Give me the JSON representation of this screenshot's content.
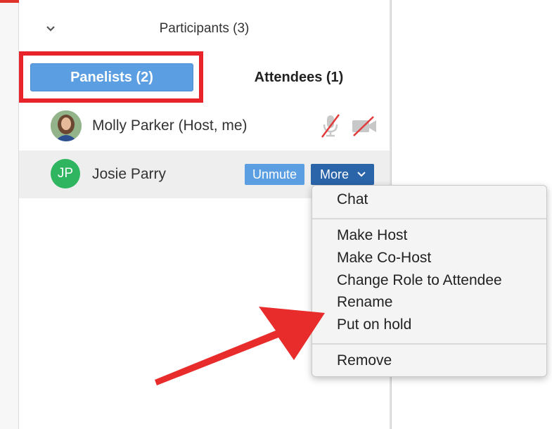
{
  "participants": {
    "header_title": "Participants (3)",
    "tabs": [
      {
        "label": "Panelists (2)",
        "active": true
      },
      {
        "label": "Attendees (1)",
        "active": false
      }
    ],
    "rows": [
      {
        "name": "Molly Parker (Host, me)",
        "avatar": "photo",
        "mic": "muted",
        "video": "off"
      },
      {
        "name": "Josie Parry",
        "avatar_initials": "JP",
        "avatar_color": "#2fb560",
        "buttons": {
          "unmute": "Unmute",
          "more": "More"
        }
      }
    ]
  },
  "context_menu": {
    "items": [
      "Chat",
      "Make Host",
      "Make Co-Host",
      "Change Role to Attendee",
      "Rename",
      "Put on hold",
      "Remove"
    ]
  },
  "colors": {
    "accent_blue": "#5b9fe2",
    "more_button": "#2a64a9",
    "highlight_red": "#e8232a",
    "arrow_red": "#e82b2b"
  }
}
